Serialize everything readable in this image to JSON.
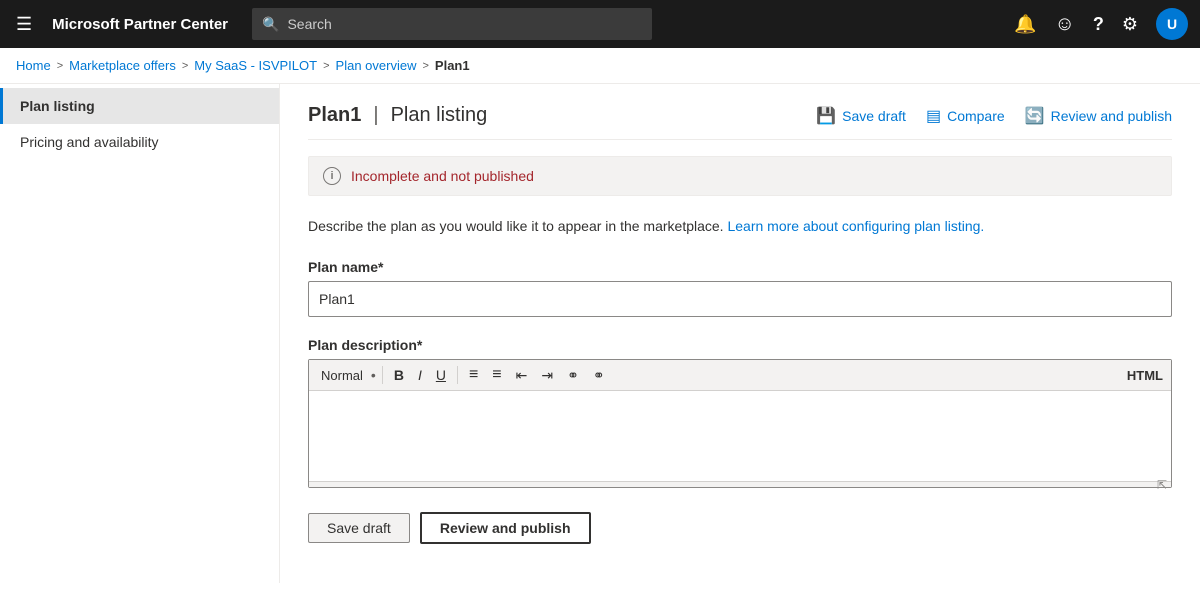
{
  "app": {
    "title": "Microsoft Partner Center"
  },
  "topnav": {
    "hamburger_icon": "☰",
    "search_placeholder": "Search",
    "notification_icon": "🔔",
    "smiley_icon": "☺",
    "help_icon": "?",
    "settings_icon": "⚙",
    "avatar_label": "U"
  },
  "breadcrumb": {
    "items": [
      {
        "label": "Home",
        "href": "#"
      },
      {
        "label": "Marketplace offers",
        "href": "#"
      },
      {
        "label": "My SaaS - ISVPILOT",
        "href": "#"
      },
      {
        "label": "Plan overview",
        "href": "#"
      },
      {
        "label": "Plan1",
        "current": true
      }
    ],
    "separators": [
      ">",
      ">",
      ">",
      ">"
    ]
  },
  "sidebar": {
    "items": [
      {
        "label": "Plan listing",
        "active": true
      },
      {
        "label": "Pricing and availability",
        "active": false
      }
    ]
  },
  "page": {
    "plan_name": "Plan1",
    "section_title": "Plan listing",
    "separator": "|",
    "save_draft_label": "Save draft",
    "compare_label": "Compare",
    "review_publish_label": "Review and publish",
    "info_banner": "Incomplete and not published",
    "description_static": "Describe the plan as you would like it to appear in the marketplace.",
    "description_link_text": "Learn more about configuring plan listing.",
    "description_link_href": "#",
    "plan_name_label": "Plan name*",
    "plan_name_value": "Plan1",
    "plan_name_placeholder": "",
    "plan_description_label": "Plan description*",
    "rte_format_default": "Normal",
    "rte_html_label": "HTML",
    "rte_bold": "B",
    "rte_italic": "I",
    "rte_underline": "U",
    "rte_ol": "≡",
    "rte_ul": "≡",
    "rte_indent_left": "⇤",
    "rte_indent_right": "⇥",
    "rte_link": "⚭",
    "rte_unlink": "⚭",
    "rte_body_placeholder": "",
    "save_draft_btn": "Save draft",
    "review_publish_btn": "Review and publish"
  }
}
